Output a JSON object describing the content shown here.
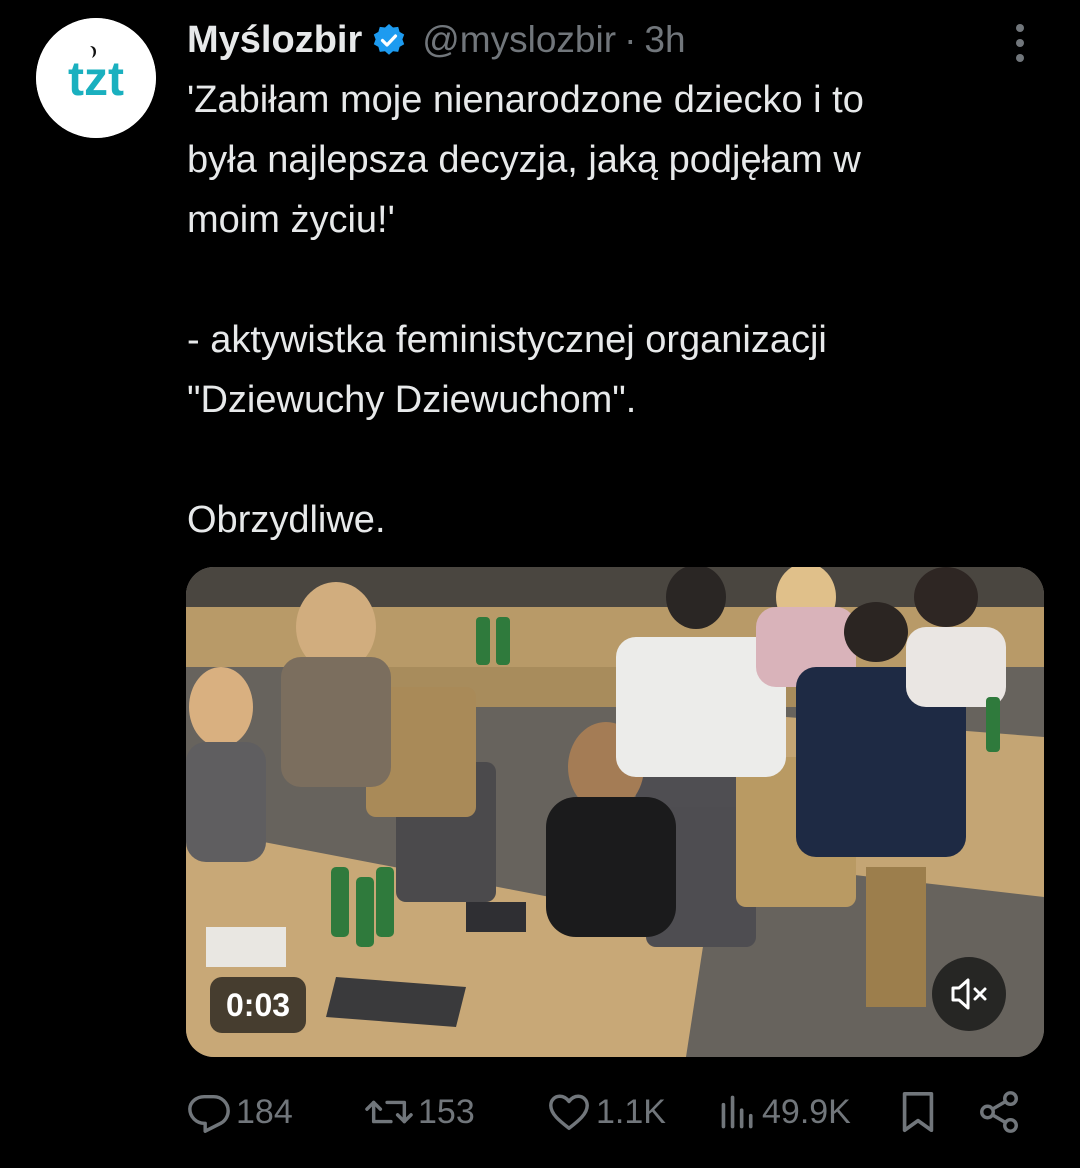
{
  "author": {
    "display_name": "Myślozbir",
    "handle": "@myslozbir",
    "separator": "·",
    "time": "3h",
    "avatar_text": "tzt",
    "avatar_color": "#1ab0bf",
    "verified": true,
    "verified_color": "#1d9bf0"
  },
  "tweet": {
    "lines": [
      "'Zabiłam moje nienarodzone dziecko i to",
      "była najlepsza decyzja, jaką podjęłam w",
      "moim życiu!'",
      "",
      "- aktywistka feministycznej organizacji",
      "\"Dziewuchy Dziewuchom\".",
      "",
      "Obrzydliwe."
    ]
  },
  "media": {
    "type": "video",
    "timestamp": "0:03",
    "muted": true,
    "mute_icon": "volume-muted-icon"
  },
  "actions": {
    "replies": {
      "icon": "reply-icon",
      "count": "184"
    },
    "retweets": {
      "icon": "retweet-icon",
      "count": "153"
    },
    "likes": {
      "icon": "heart-icon",
      "count": "1.1K"
    },
    "views": {
      "icon": "views-icon",
      "count": "49.9K"
    },
    "bookmark": {
      "icon": "bookmark-icon"
    },
    "share": {
      "icon": "share-icon"
    }
  },
  "colors": {
    "background": "#000000",
    "text": "#e7e9ea",
    "secondary": "#71767b"
  }
}
